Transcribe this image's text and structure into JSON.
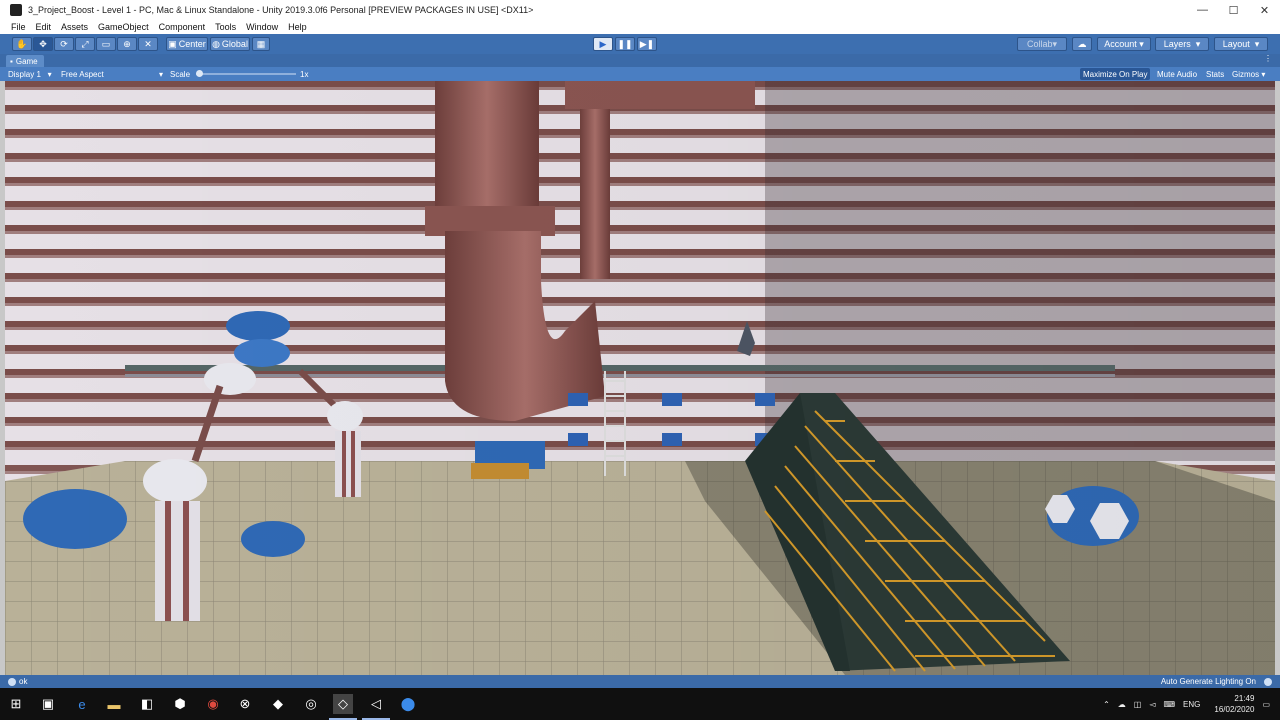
{
  "window": {
    "title": "3_Project_Boost - Level 1 - PC, Mac & Linux Standalone - Unity 2019.3.0f6 Personal [PREVIEW PACKAGES IN USE] <DX11>"
  },
  "menu": [
    "File",
    "Edit",
    "Assets",
    "GameObject",
    "Component",
    "Tools",
    "Window",
    "Help"
  ],
  "toolbar": {
    "pivot_label": "Center",
    "space_label": "Global",
    "collab_label": "Collab",
    "account_label": "Account",
    "layers_label": "Layers",
    "layout_label": "Layout"
  },
  "tab": {
    "label": "Game"
  },
  "game_toolbar": {
    "display": "Display 1",
    "aspect": "Free Aspect",
    "scale_label": "Scale",
    "scale_value": "1x",
    "maximize": "Maximize On Play",
    "mute": "Mute Audio",
    "stats": "Stats",
    "gizmos": "Gizmos"
  },
  "status": {
    "message": "ok",
    "right": "Auto Generate Lighting On"
  },
  "tray": {
    "lang": "ENG",
    "time": "21:49",
    "date": "16/02/2020"
  }
}
